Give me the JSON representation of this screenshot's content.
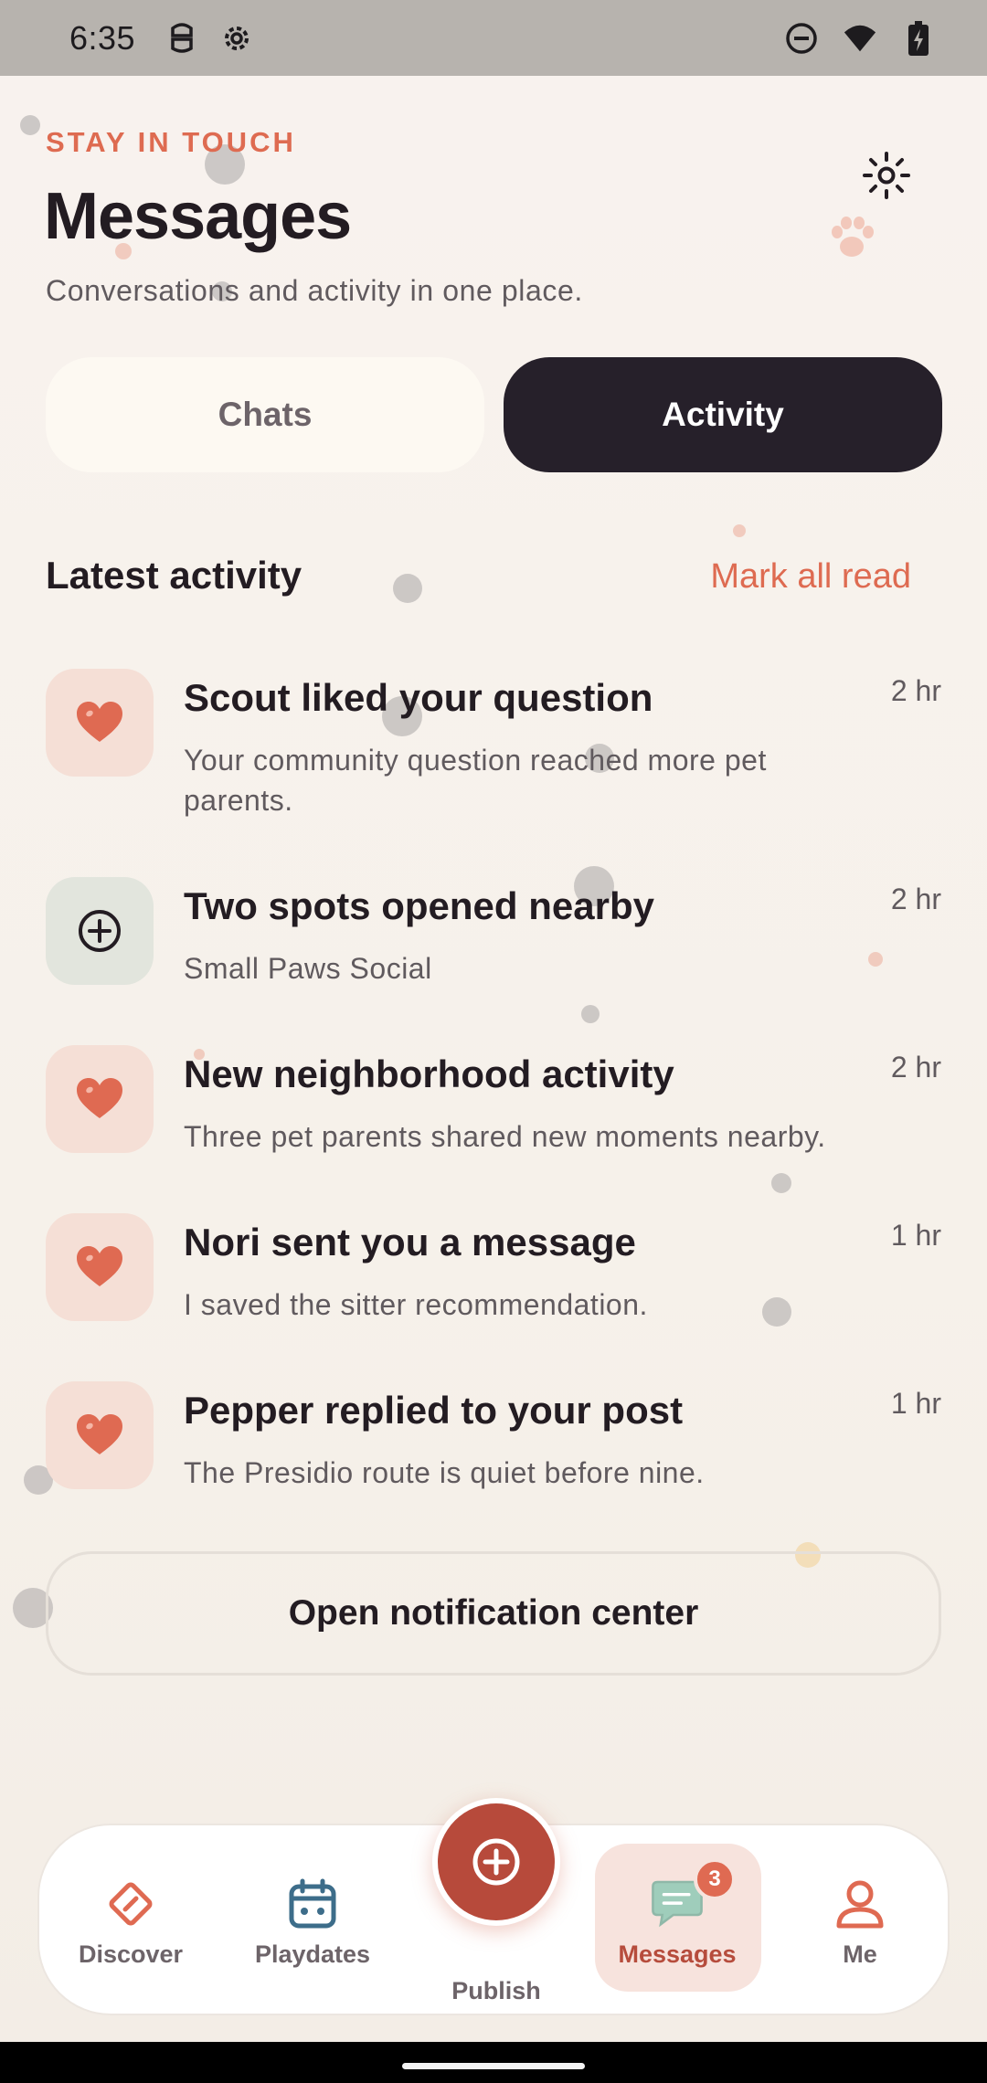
{
  "status_bar": {
    "time": "6:35",
    "left_icons": [
      "android-head-icon",
      "gear-icon"
    ],
    "right_icons": [
      "do-not-disturb-icon",
      "wifi-icon",
      "battery-charging-icon"
    ]
  },
  "header": {
    "eyebrow": "STAY IN TOUCH",
    "title": "Messages",
    "subtitle": "Conversations and activity in one place.",
    "theme_icon": "sun-icon"
  },
  "tabs": [
    {
      "label": "Chats",
      "selected": false
    },
    {
      "label": "Activity",
      "selected": true
    }
  ],
  "section": {
    "title": "Latest activity",
    "action_label": "Mark all read"
  },
  "activity": [
    {
      "icon": "heart-icon",
      "title": "Scout liked your question",
      "body": "Your community question reached more pet parents.",
      "time": "2 hr"
    },
    {
      "icon": "plus-circle-icon",
      "title": "Two spots opened nearby",
      "body": "Small Paws Social",
      "time": "2 hr"
    },
    {
      "icon": "heart-icon",
      "title": "New neighborhood activity",
      "body": "Three pet parents shared new moments nearby.",
      "time": "2 hr"
    },
    {
      "icon": "heart-icon",
      "title": "Nori sent you a message",
      "body": "I saved the sitter recommendation.",
      "time": "1 hr"
    },
    {
      "icon": "heart-icon",
      "title": "Pepper replied to your post",
      "body": "The Presidio route is quiet before nine.",
      "time": "1 hr"
    }
  ],
  "open_center_label": "Open notification center",
  "bottom_nav": {
    "items": [
      {
        "label": "Discover",
        "icon": "compass-diamond-icon"
      },
      {
        "label": "Playdates",
        "icon": "calendar-icon"
      },
      {
        "label": "Publish",
        "icon": "plus-circle-icon"
      },
      {
        "label": "Messages",
        "icon": "chat-bubble-icon",
        "badge": "3",
        "active": true
      },
      {
        "label": "Me",
        "icon": "person-icon"
      }
    ]
  },
  "colors": {
    "accent": "#de6b51",
    "dark": "#26202a",
    "publish": "#b74a3b",
    "active_bg": "#f7e3dd"
  }
}
